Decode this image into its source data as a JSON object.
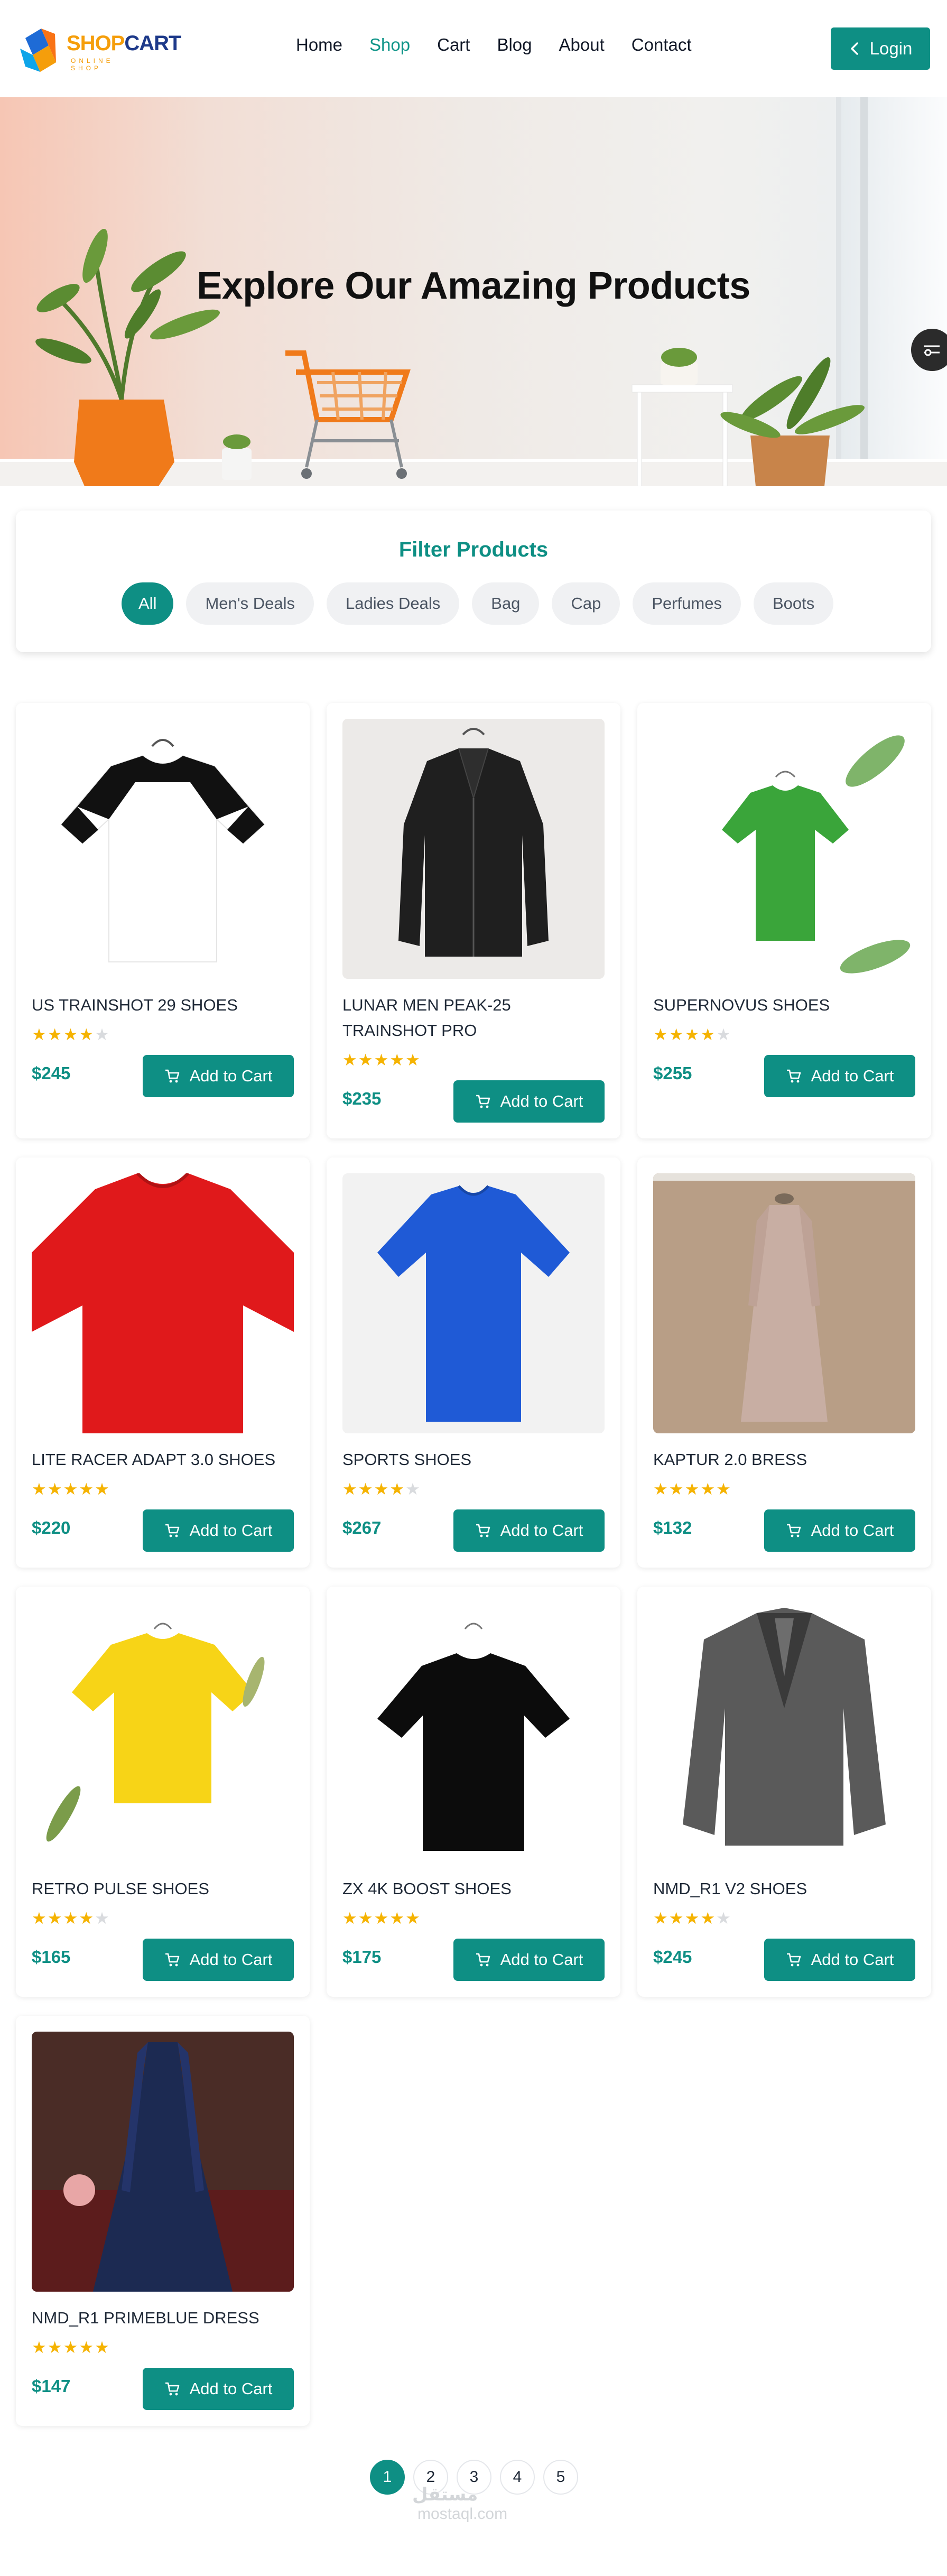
{
  "header": {
    "logo": {
      "shop": "SHOP",
      "cart": "CART",
      "tagline": "ONLINE SHOP"
    },
    "nav": [
      {
        "label": "Home",
        "active": false
      },
      {
        "label": "Shop",
        "active": true
      },
      {
        "label": "Cart",
        "active": false
      },
      {
        "label": "Blog",
        "active": false
      },
      {
        "label": "About",
        "active": false
      },
      {
        "label": "Contact",
        "active": false
      }
    ],
    "login_label": "Login",
    "login_icon": "chevron-left-icon"
  },
  "hero": {
    "title": "Explore Our Amazing Products",
    "side_tab_icon": "settings-toggle-icon"
  },
  "filter": {
    "title": "Filter Products",
    "chips": [
      {
        "label": "All",
        "active": true
      },
      {
        "label": "Men's Deals",
        "active": false
      },
      {
        "label": "Ladies Deals",
        "active": false
      },
      {
        "label": "Bag",
        "active": false
      },
      {
        "label": "Cap",
        "active": false
      },
      {
        "label": "Perfumes",
        "active": false
      },
      {
        "label": "Boots",
        "active": false
      }
    ]
  },
  "products": [
    {
      "name": "US TRAINSHOT 29 SHOES",
      "rating": 4,
      "price": "$245",
      "image": "white-black-raglan-tshirt"
    },
    {
      "name": "LUNAR MEN PEAK-25 TRAINSHOT PRO",
      "rating": 5,
      "price": "$235",
      "image": "black-leather-jacket"
    },
    {
      "name": "SUPERNOVUS SHOES",
      "rating": 4,
      "price": "$255",
      "image": "green-tshirt"
    },
    {
      "name": "LITE RACER ADAPT 3.0 SHOES",
      "rating": 5,
      "price": "$220",
      "image": "red-tshirt"
    },
    {
      "name": "SPORTS SHOES",
      "rating": 4,
      "price": "$267",
      "image": "blue-tshirt"
    },
    {
      "name": "KAPTUR 2.0 BRESS",
      "rating": 5,
      "price": "$132",
      "image": "beige-long-dress"
    },
    {
      "name": "RETRO PULSE SHOES",
      "rating": 4,
      "price": "$165",
      "image": "yellow-tshirt"
    },
    {
      "name": "ZX 4K BOOST SHOES",
      "rating": 5,
      "price": "$175",
      "image": "black-tshirt"
    },
    {
      "name": "NMD_R1 V2 SHOES",
      "rating": 4,
      "price": "$245",
      "image": "grey-blazer"
    },
    {
      "name": "NMD_R1 PRIMEBLUE DRESS",
      "rating": 5,
      "price": "$147",
      "image": "navy-lace-gown"
    }
  ],
  "add_to_cart_label": "Add to Cart",
  "pagination": {
    "pages": [
      "1",
      "2",
      "3",
      "4",
      "5"
    ],
    "current": "1"
  },
  "watermark": {
    "text": "مستقل",
    "url": "mostaql.com"
  },
  "colors": {
    "accent": "#0e8f84",
    "star": "#f5b301",
    "logo_orange": "#f59e0b",
    "logo_navy": "#1e3a8a"
  }
}
